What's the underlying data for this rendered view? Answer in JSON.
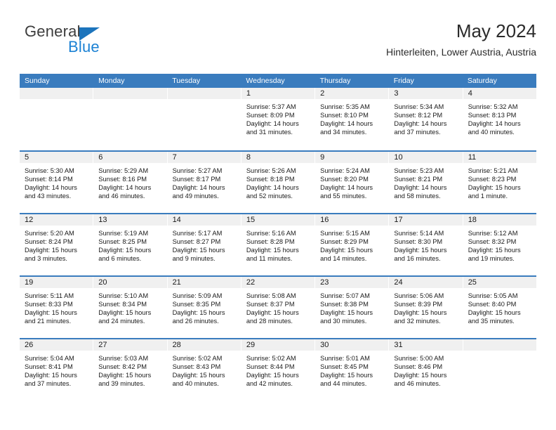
{
  "brand": {
    "name_top": "General",
    "name_bottom": "Blue",
    "triangle_color": "#1c74bc",
    "blue_color": "#1c82d4"
  },
  "header": {
    "title": "May 2024",
    "location": "Hinterleiten, Lower Austria, Austria"
  },
  "theme": {
    "header_bg": "#3a7cbe",
    "header_text": "#ffffff",
    "daynum_band": "#f0f0f0",
    "row_divider": "#3a7cbe"
  },
  "weekday_headers": [
    "Sunday",
    "Monday",
    "Tuesday",
    "Wednesday",
    "Thursday",
    "Friday",
    "Saturday"
  ],
  "labels": {
    "sunrise_prefix": "Sunrise:",
    "sunset_prefix": "Sunset:",
    "daylight_prefix": "Daylight:"
  },
  "weeks": [
    [
      {
        "day": "",
        "empty": true
      },
      {
        "day": "",
        "empty": true
      },
      {
        "day": "",
        "empty": true
      },
      {
        "day": "1",
        "sunrise": "Sunrise: 5:37 AM",
        "sunset": "Sunset: 8:09 PM",
        "daylight_1": "Daylight: 14 hours",
        "daylight_2": "and 31 minutes."
      },
      {
        "day": "2",
        "sunrise": "Sunrise: 5:35 AM",
        "sunset": "Sunset: 8:10 PM",
        "daylight_1": "Daylight: 14 hours",
        "daylight_2": "and 34 minutes."
      },
      {
        "day": "3",
        "sunrise": "Sunrise: 5:34 AM",
        "sunset": "Sunset: 8:12 PM",
        "daylight_1": "Daylight: 14 hours",
        "daylight_2": "and 37 minutes."
      },
      {
        "day": "4",
        "sunrise": "Sunrise: 5:32 AM",
        "sunset": "Sunset: 8:13 PM",
        "daylight_1": "Daylight: 14 hours",
        "daylight_2": "and 40 minutes."
      }
    ],
    [
      {
        "day": "5",
        "sunrise": "Sunrise: 5:30 AM",
        "sunset": "Sunset: 8:14 PM",
        "daylight_1": "Daylight: 14 hours",
        "daylight_2": "and 43 minutes."
      },
      {
        "day": "6",
        "sunrise": "Sunrise: 5:29 AM",
        "sunset": "Sunset: 8:16 PM",
        "daylight_1": "Daylight: 14 hours",
        "daylight_2": "and 46 minutes."
      },
      {
        "day": "7",
        "sunrise": "Sunrise: 5:27 AM",
        "sunset": "Sunset: 8:17 PM",
        "daylight_1": "Daylight: 14 hours",
        "daylight_2": "and 49 minutes."
      },
      {
        "day": "8",
        "sunrise": "Sunrise: 5:26 AM",
        "sunset": "Sunset: 8:18 PM",
        "daylight_1": "Daylight: 14 hours",
        "daylight_2": "and 52 minutes."
      },
      {
        "day": "9",
        "sunrise": "Sunrise: 5:24 AM",
        "sunset": "Sunset: 8:20 PM",
        "daylight_1": "Daylight: 14 hours",
        "daylight_2": "and 55 minutes."
      },
      {
        "day": "10",
        "sunrise": "Sunrise: 5:23 AM",
        "sunset": "Sunset: 8:21 PM",
        "daylight_1": "Daylight: 14 hours",
        "daylight_2": "and 58 minutes."
      },
      {
        "day": "11",
        "sunrise": "Sunrise: 5:21 AM",
        "sunset": "Sunset: 8:23 PM",
        "daylight_1": "Daylight: 15 hours",
        "daylight_2": "and 1 minute."
      }
    ],
    [
      {
        "day": "12",
        "sunrise": "Sunrise: 5:20 AM",
        "sunset": "Sunset: 8:24 PM",
        "daylight_1": "Daylight: 15 hours",
        "daylight_2": "and 3 minutes."
      },
      {
        "day": "13",
        "sunrise": "Sunrise: 5:19 AM",
        "sunset": "Sunset: 8:25 PM",
        "daylight_1": "Daylight: 15 hours",
        "daylight_2": "and 6 minutes."
      },
      {
        "day": "14",
        "sunrise": "Sunrise: 5:17 AM",
        "sunset": "Sunset: 8:27 PM",
        "daylight_1": "Daylight: 15 hours",
        "daylight_2": "and 9 minutes."
      },
      {
        "day": "15",
        "sunrise": "Sunrise: 5:16 AM",
        "sunset": "Sunset: 8:28 PM",
        "daylight_1": "Daylight: 15 hours",
        "daylight_2": "and 11 minutes."
      },
      {
        "day": "16",
        "sunrise": "Sunrise: 5:15 AM",
        "sunset": "Sunset: 8:29 PM",
        "daylight_1": "Daylight: 15 hours",
        "daylight_2": "and 14 minutes."
      },
      {
        "day": "17",
        "sunrise": "Sunrise: 5:14 AM",
        "sunset": "Sunset: 8:30 PM",
        "daylight_1": "Daylight: 15 hours",
        "daylight_2": "and 16 minutes."
      },
      {
        "day": "18",
        "sunrise": "Sunrise: 5:12 AM",
        "sunset": "Sunset: 8:32 PM",
        "daylight_1": "Daylight: 15 hours",
        "daylight_2": "and 19 minutes."
      }
    ],
    [
      {
        "day": "19",
        "sunrise": "Sunrise: 5:11 AM",
        "sunset": "Sunset: 8:33 PM",
        "daylight_1": "Daylight: 15 hours",
        "daylight_2": "and 21 minutes."
      },
      {
        "day": "20",
        "sunrise": "Sunrise: 5:10 AM",
        "sunset": "Sunset: 8:34 PM",
        "daylight_1": "Daylight: 15 hours",
        "daylight_2": "and 24 minutes."
      },
      {
        "day": "21",
        "sunrise": "Sunrise: 5:09 AM",
        "sunset": "Sunset: 8:35 PM",
        "daylight_1": "Daylight: 15 hours",
        "daylight_2": "and 26 minutes."
      },
      {
        "day": "22",
        "sunrise": "Sunrise: 5:08 AM",
        "sunset": "Sunset: 8:37 PM",
        "daylight_1": "Daylight: 15 hours",
        "daylight_2": "and 28 minutes."
      },
      {
        "day": "23",
        "sunrise": "Sunrise: 5:07 AM",
        "sunset": "Sunset: 8:38 PM",
        "daylight_1": "Daylight: 15 hours",
        "daylight_2": "and 30 minutes."
      },
      {
        "day": "24",
        "sunrise": "Sunrise: 5:06 AM",
        "sunset": "Sunset: 8:39 PM",
        "daylight_1": "Daylight: 15 hours",
        "daylight_2": "and 32 minutes."
      },
      {
        "day": "25",
        "sunrise": "Sunrise: 5:05 AM",
        "sunset": "Sunset: 8:40 PM",
        "daylight_1": "Daylight: 15 hours",
        "daylight_2": "and 35 minutes."
      }
    ],
    [
      {
        "day": "26",
        "sunrise": "Sunrise: 5:04 AM",
        "sunset": "Sunset: 8:41 PM",
        "daylight_1": "Daylight: 15 hours",
        "daylight_2": "and 37 minutes."
      },
      {
        "day": "27",
        "sunrise": "Sunrise: 5:03 AM",
        "sunset": "Sunset: 8:42 PM",
        "daylight_1": "Daylight: 15 hours",
        "daylight_2": "and 39 minutes."
      },
      {
        "day": "28",
        "sunrise": "Sunrise: 5:02 AM",
        "sunset": "Sunset: 8:43 PM",
        "daylight_1": "Daylight: 15 hours",
        "daylight_2": "and 40 minutes."
      },
      {
        "day": "29",
        "sunrise": "Sunrise: 5:02 AM",
        "sunset": "Sunset: 8:44 PM",
        "daylight_1": "Daylight: 15 hours",
        "daylight_2": "and 42 minutes."
      },
      {
        "day": "30",
        "sunrise": "Sunrise: 5:01 AM",
        "sunset": "Sunset: 8:45 PM",
        "daylight_1": "Daylight: 15 hours",
        "daylight_2": "and 44 minutes."
      },
      {
        "day": "31",
        "sunrise": "Sunrise: 5:00 AM",
        "sunset": "Sunset: 8:46 PM",
        "daylight_1": "Daylight: 15 hours",
        "daylight_2": "and 46 minutes."
      },
      {
        "day": "",
        "empty": true
      }
    ]
  ]
}
